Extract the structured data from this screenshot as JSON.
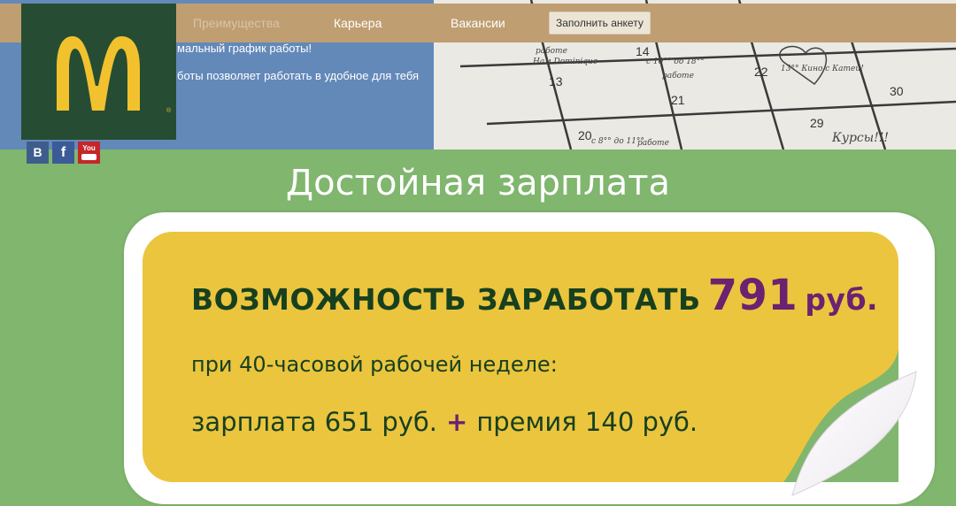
{
  "hero": {
    "text_line1": "мальный график работы!",
    "text_line2": "боты позволяет работать в удобное для тебя",
    "calendar": {
      "days": [
        "13",
        "14",
        "20",
        "21",
        "22",
        "29",
        "30"
      ],
      "notes": [
        "работе",
        "Нам Dominique",
        "с 10°° до 18°°",
        "работе",
        "13°° Кино с Катей!",
        "с 8°° до 11°°",
        "работе",
        "Курсы!!!"
      ]
    }
  },
  "nav": {
    "items": [
      "Преимущества",
      "Карьера",
      "Вакансии"
    ],
    "cta_label": "Заполнить анкету"
  },
  "social": {
    "vk": "B",
    "fb": "f",
    "yt": "You"
  },
  "salary": {
    "title": "Достойная зарплата",
    "line1_text": "ВОЗМОЖНОСТЬ ЗАРАБОТАТЬ",
    "line1_amount": "791",
    "line1_currency": "руб.",
    "line2": "при 40-часовой рабочей неделе:",
    "line3_left": "зарплата  651 руб.",
    "line3_plus": "+",
    "line3_right": "премия 140 руб."
  },
  "colors": {
    "page_bg": "#80b66e",
    "nav_bg": "#bf9e72",
    "logo_bg": "#264d33",
    "logo_arches": "#f2c12e",
    "card_yellow": "#ebc53e",
    "accent_purple": "#6b2270",
    "text_dark_green": "#17401f"
  }
}
